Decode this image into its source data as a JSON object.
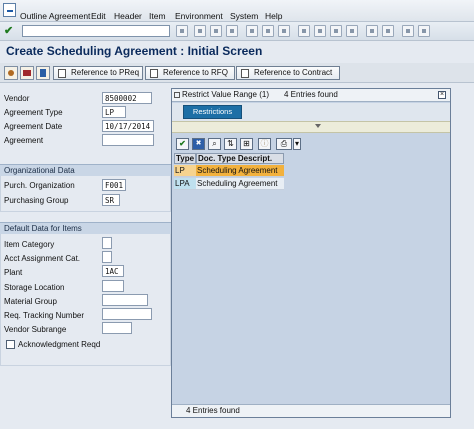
{
  "menubar": {
    "items": [
      "Outline Agreement",
      "Edit",
      "Header",
      "Item",
      "Environment",
      "System",
      "Help"
    ]
  },
  "page_title": "Create Scheduling Agreement : Initial Screen",
  "appbar": {
    "buttons": [
      "Reference to PReq",
      "Reference to RFQ",
      "Reference to Contract"
    ]
  },
  "header_fields": {
    "vendor_label": "Vendor",
    "vendor_value": "8500002",
    "agreement_type_label": "Agreement Type",
    "agreement_type_value": "LP",
    "agreement_date_label": "Agreement Date",
    "agreement_date_value": "10/17/2014",
    "agreement_label": "Agreement",
    "agreement_value": ""
  },
  "org_data": {
    "section_title": "Organizational Data",
    "purch_org_label": "Purch. Organization",
    "purch_org_value": "F001",
    "purch_group_label": "Purchasing Group",
    "purch_group_value": "SR"
  },
  "default_data": {
    "section_title": "Default Data for Items",
    "item_category_label": "Item Category",
    "item_category_value": "",
    "acct_assign_label": "Acct Assignment Cat.",
    "acct_assign_value": "",
    "plant_label": "Plant",
    "plant_value": "1AC",
    "storage_label": "Storage Location",
    "storage_value": "",
    "material_group_label": "Material Group",
    "material_group_value": "",
    "tracking_label": "Req. Tracking Number",
    "tracking_value": "",
    "subrange_label": "Vendor Subrange",
    "subrange_value": "",
    "ack_label": "Acknowledgment Reqd",
    "ack_checked": false
  },
  "dialog": {
    "title_left": "Restrict Value Range (1)",
    "title_right": "4 Entries found",
    "tab_label": "Restrictions",
    "columns": [
      "Type",
      "Doc. Type Descript."
    ],
    "rows": [
      {
        "type": "LP",
        "desc": "Scheduling Agreement"
      },
      {
        "type": "LPA",
        "desc": "Scheduling Agreement"
      }
    ],
    "status": "4 Entries found",
    "selected_row_color": "#f2b13d"
  }
}
